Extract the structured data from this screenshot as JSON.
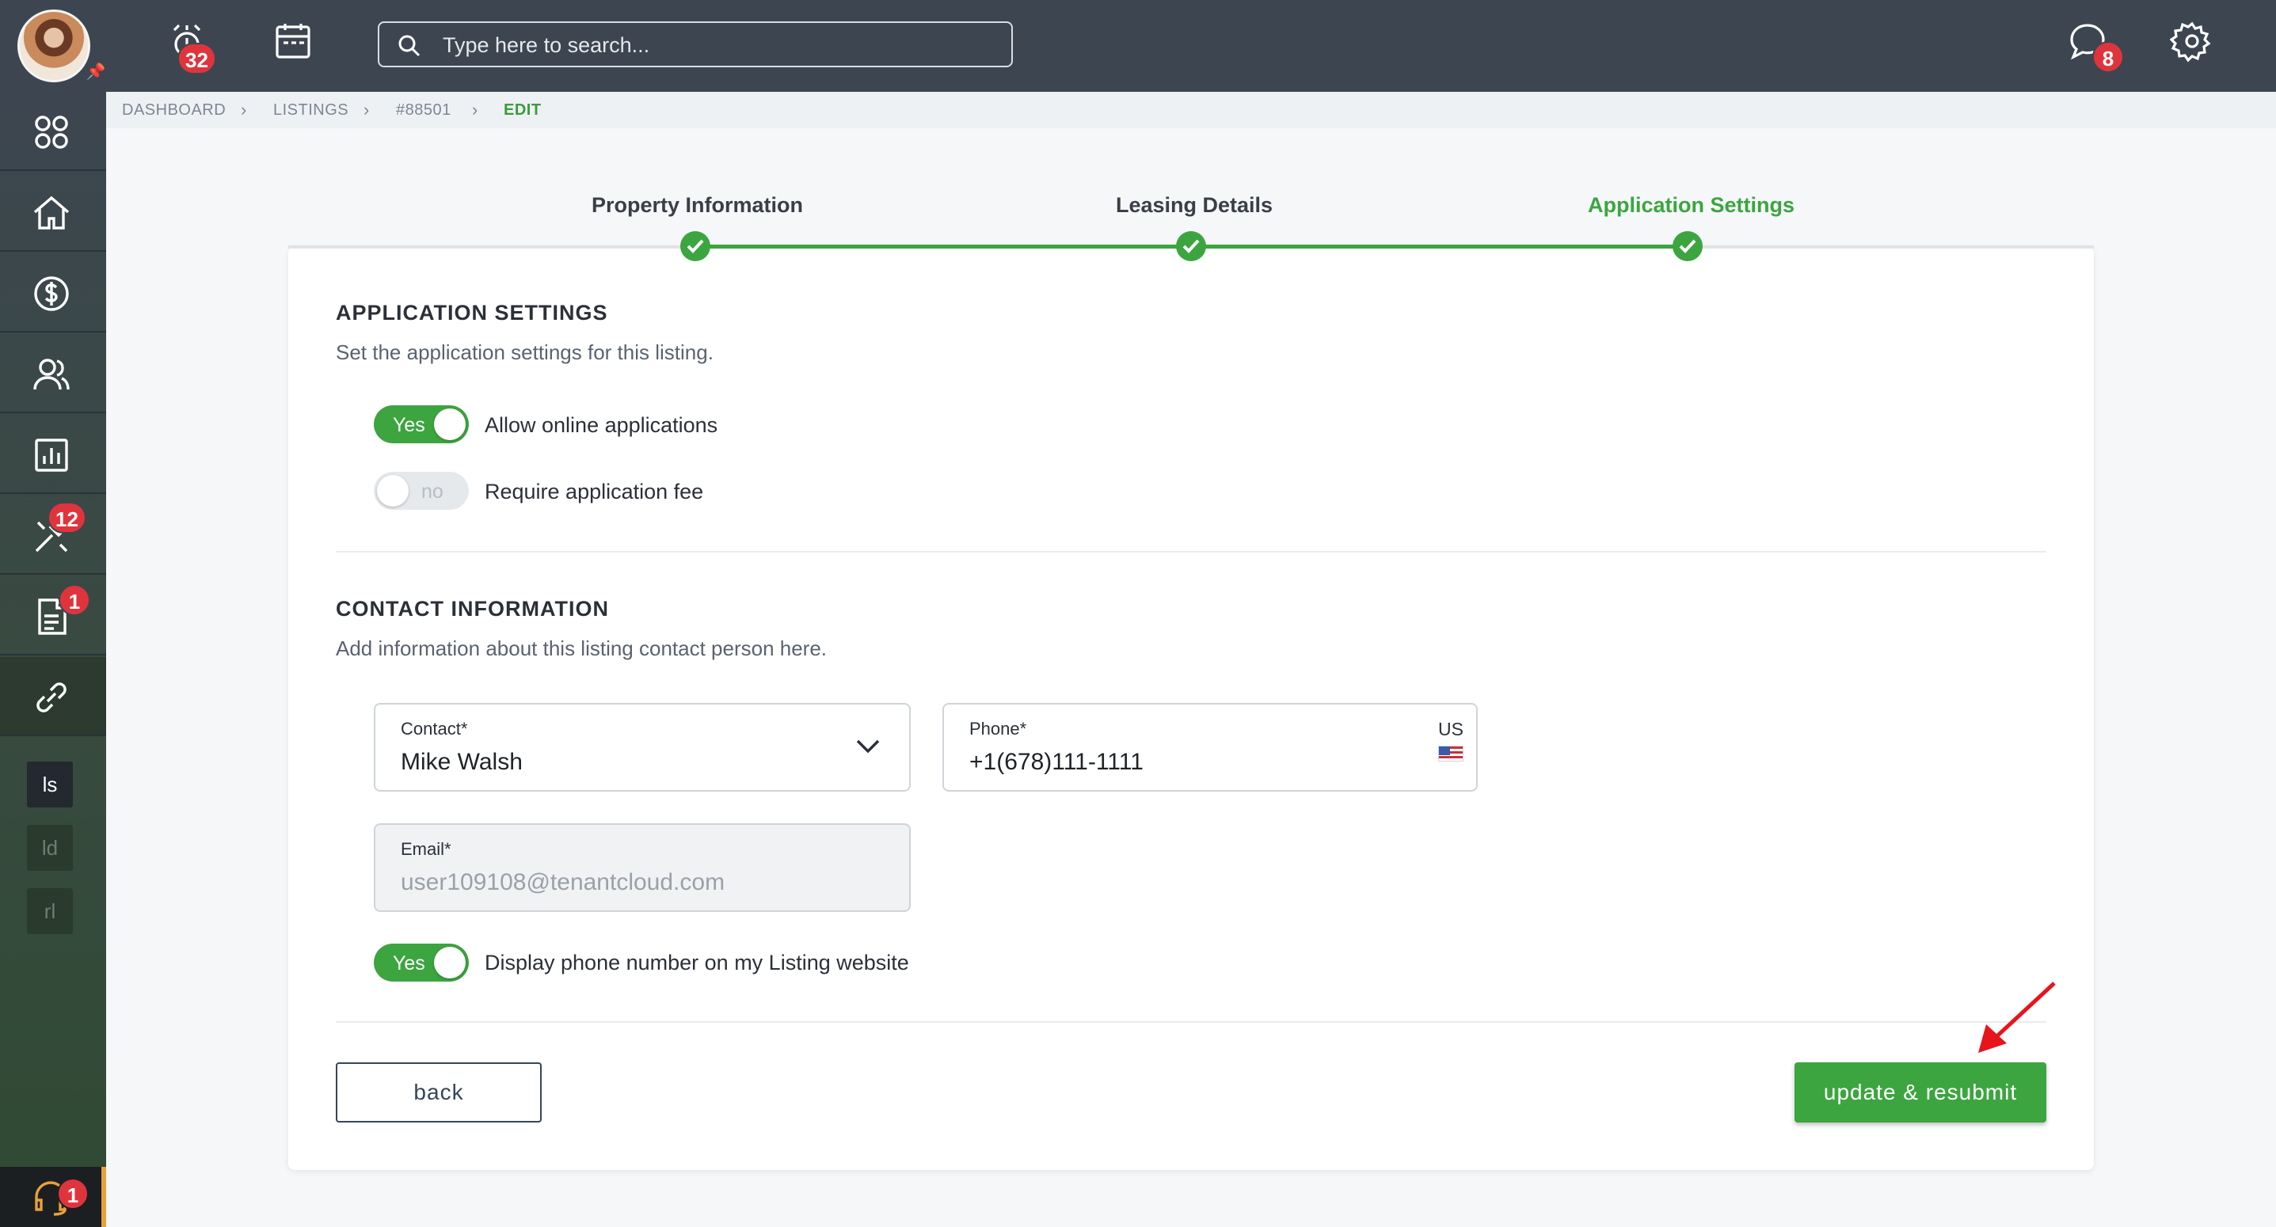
{
  "topbar": {
    "search_placeholder": "Type here to search...",
    "alarm_badge": "32",
    "chat_badge": "8"
  },
  "sidebar": {
    "maintenance_badge": "12",
    "documents_badge": "1",
    "help_badge": "1",
    "chips": [
      "ls",
      "ld",
      "rl"
    ]
  },
  "breadcrumb": {
    "items": [
      "DASHBOARD",
      "LISTINGS",
      "#88501",
      "EDIT"
    ]
  },
  "steps": [
    {
      "label": "Property Information",
      "status": "complete"
    },
    {
      "label": "Leasing Details",
      "status": "complete"
    },
    {
      "label": "Application Settings",
      "status": "active"
    }
  ],
  "application_settings": {
    "title": "APPLICATION SETTINGS",
    "subtitle": "Set the application settings for this listing.",
    "allow_online": {
      "state": "Yes",
      "label": "Allow online applications"
    },
    "require_fee": {
      "state": "no",
      "label": "Require application fee"
    }
  },
  "contact_information": {
    "title": "CONTACT INFORMATION",
    "subtitle": "Add information about this listing contact person here.",
    "contact": {
      "label": "Contact*",
      "value": "Mike Walsh"
    },
    "phone": {
      "label": "Phone*",
      "value": "+1(678)111-1111",
      "country": "US"
    },
    "email": {
      "label": "Email*",
      "value": "user109108@tenantcloud.com"
    },
    "display_phone": {
      "state": "Yes",
      "label": "Display phone number on my Listing website"
    }
  },
  "actions": {
    "back_label": "back",
    "submit_label": "update & resubmit"
  },
  "colors": {
    "accent": "#3ca53f",
    "topbar": "#3d4650",
    "badge": "#e0343d",
    "annotation_arrow": "#e8141c"
  }
}
